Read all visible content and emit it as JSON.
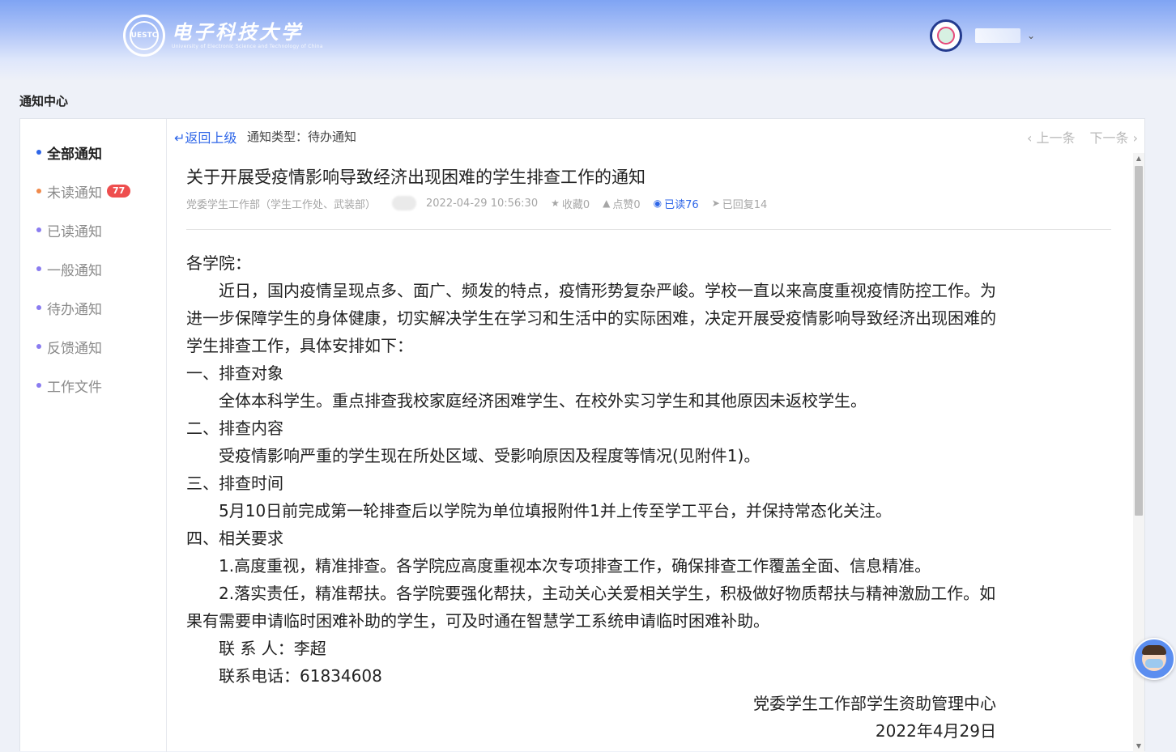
{
  "header": {
    "logo_cn": "电子科技大学",
    "logo_en": "University of Electronic Science and Technology of China",
    "seal_text": "UESTC",
    "chevron": "chevron-down-icon"
  },
  "page": {
    "title": "通知中心"
  },
  "sidebar": {
    "items": [
      {
        "label": "全部通知",
        "active": true
      },
      {
        "label": "未读通知",
        "badge": "77"
      },
      {
        "label": "已读通知"
      },
      {
        "label": "一般通知"
      },
      {
        "label": "待办通知"
      },
      {
        "label": "反馈通知"
      },
      {
        "label": "工作文件"
      }
    ]
  },
  "toolbar": {
    "back_label": "返回上级",
    "notice_type": "通知类型：待办通知",
    "prev_label": "上一条",
    "next_label": "下一条"
  },
  "article": {
    "title": "关于开展受疫情影响导致经济出现困难的学生排查工作的通知",
    "meta": {
      "department": "党委学生工作部（学生工作处、武装部）",
      "datetime": "2022-04-29 10:56:30",
      "favorites": "收藏0",
      "likes": "点赞0",
      "reads": "已读76",
      "replies": "已回复14"
    },
    "paragraphs": [
      {
        "text": "各学院：",
        "style": "plain"
      },
      {
        "text": "近日，国内疫情呈现点多、面广、频发的特点，疫情形势复杂严峻。学校一直以来高度重视疫情防控工作。为进一步保障学生的身体健康，切实解决学生在学习和生活中的实际困难，决定开展受疫情影响导致经济出现困难的学生排查工作，具体安排如下：",
        "style": "indent"
      },
      {
        "text": "一、排查对象",
        "style": "plain"
      },
      {
        "text": "全体本科学生。重点排查我校家庭经济困难学生、在校外实习学生和其他原因未返校学生。",
        "style": "indent"
      },
      {
        "text": "二、排查内容",
        "style": "plain"
      },
      {
        "text": "受疫情影响严重的学生现在所处区域、受影响原因及程度等情况(见附件1)。",
        "style": "indent"
      },
      {
        "text": "三、排查时间",
        "style": "plain"
      },
      {
        "text": "5月10日前完成第一轮排查后以学院为单位填报附件1并上传至学工平台，并保持常态化关注。",
        "style": "indent"
      },
      {
        "text": "四、相关要求",
        "style": "plain"
      },
      {
        "text": "1.高度重视，精准排查。各学院应高度重视本次专项排查工作，确保排查工作覆盖全面、信息精准。",
        "style": "indent"
      },
      {
        "text": "2.落实责任，精准帮扶。各学院要强化帮扶，主动关心关爱相关学生，积极做好物质帮扶与精神激励工作。如果有需要申请临时困难补助的学生，可及时通在智慧学工系统申请临时困难补助。",
        "style": "indent"
      },
      {
        "text": "联 系 人：李超",
        "style": "indent"
      },
      {
        "text": "联系电话：61834608",
        "style": "indent"
      },
      {
        "text": "党委学生工作部学生资助管理中心",
        "style": "right"
      },
      {
        "text": "2022年4月29日",
        "style": "right"
      }
    ]
  },
  "colors": {
    "accent": "#2e66e8",
    "badge": "#ee4e4e",
    "header_gradient_top": "#7fa4f3"
  }
}
